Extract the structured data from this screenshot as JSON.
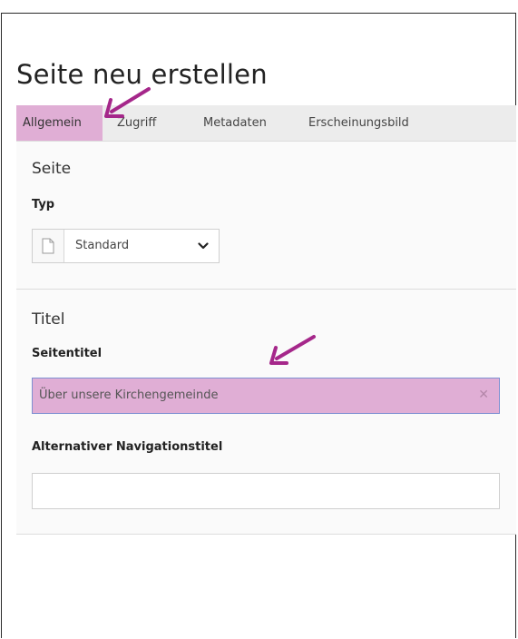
{
  "page": {
    "title": "Seite neu erstellen"
  },
  "tabs": [
    {
      "label": "Allgemein",
      "active": true
    },
    {
      "label": "Zugriff",
      "active": false
    },
    {
      "label": "Metadaten",
      "active": false
    },
    {
      "label": "Erscheinungsbild",
      "active": false
    }
  ],
  "section_page": {
    "heading": "Seite",
    "type_label": "Typ",
    "type_select": {
      "icon": "page-icon",
      "value": "Standard"
    }
  },
  "section_title": {
    "heading": "Titel",
    "page_title_label": "Seitentitel",
    "page_title_value": "Über unsere Kirchengemeinde",
    "nav_title_label": "Alternativer Navigationstitel",
    "nav_title_value": ""
  },
  "annotations": {
    "arrow_color": "#a5278a"
  },
  "colors": {
    "highlight": "#e0aed5",
    "tabbar": "#ececec",
    "focus_border": "#7d8fd1"
  }
}
